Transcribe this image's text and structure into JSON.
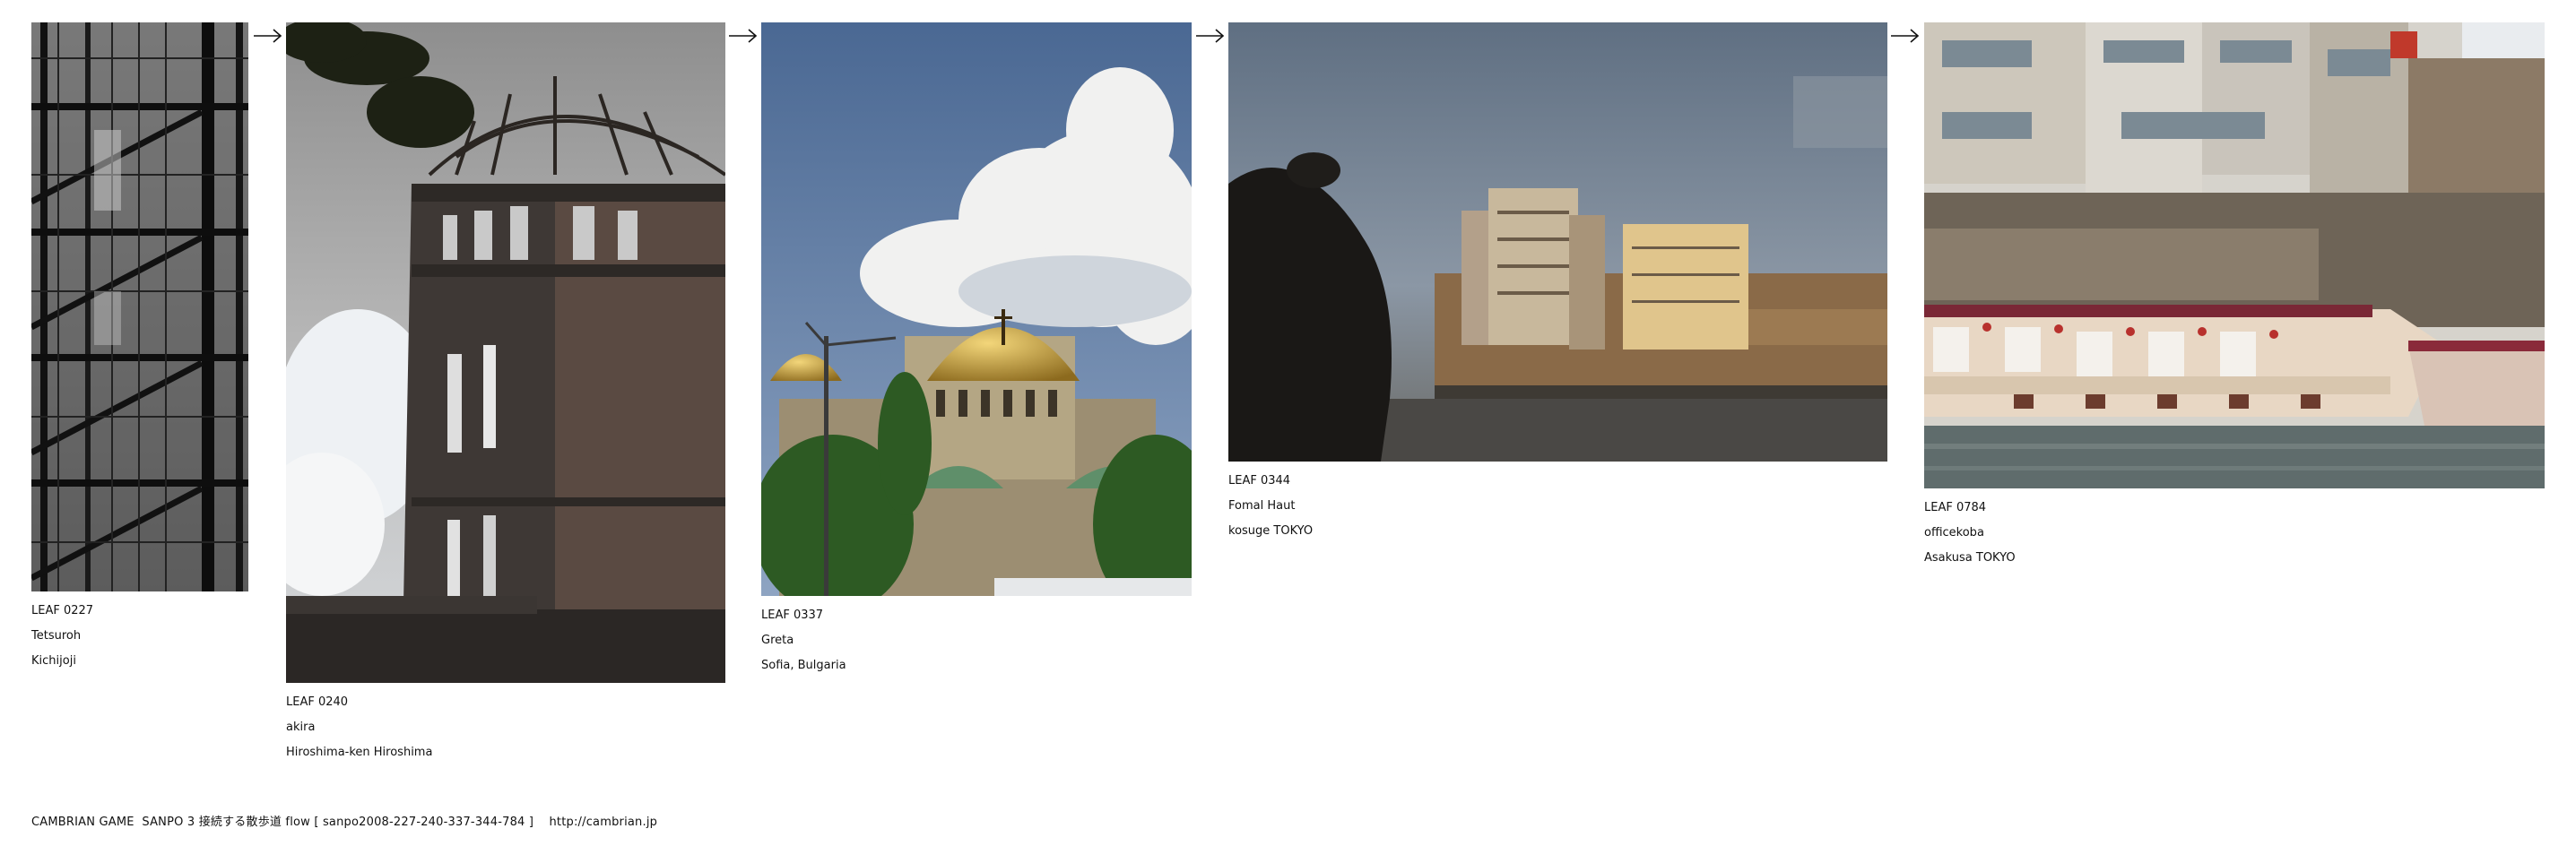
{
  "leaves": [
    {
      "id": "LEAF 0227",
      "author": "Tetsuroh",
      "place": "Kichijoji",
      "photo": "fire-escape-staircase-photo"
    },
    {
      "id": "LEAF 0240",
      "author": "akira",
      "place": "Hiroshima-ken Hiroshima",
      "photo": "atomic-bomb-dome-photo"
    },
    {
      "id": "LEAF 0337",
      "author": "Greta",
      "place": "Sofia, Bulgaria",
      "photo": "cathedral-golden-domes-photo"
    },
    {
      "id": "LEAF 0344",
      "author": "Fomal Haut",
      "place": "kosuge TOKYO",
      "photo": "buildings-through-window-photo"
    },
    {
      "id": "LEAF 0784",
      "author": "officekoba",
      "place": "Asakusa TOKYO",
      "photo": "river-boat-houseboat-photo"
    }
  ],
  "footer": {
    "text": "CAMBRIAN GAME  SANPO 3 接続する散歩道 flow [ sanpo2008-227-240-337-344-784 ]    http://cambrian.jp"
  },
  "arrow_icon": "right-arrow-icon"
}
